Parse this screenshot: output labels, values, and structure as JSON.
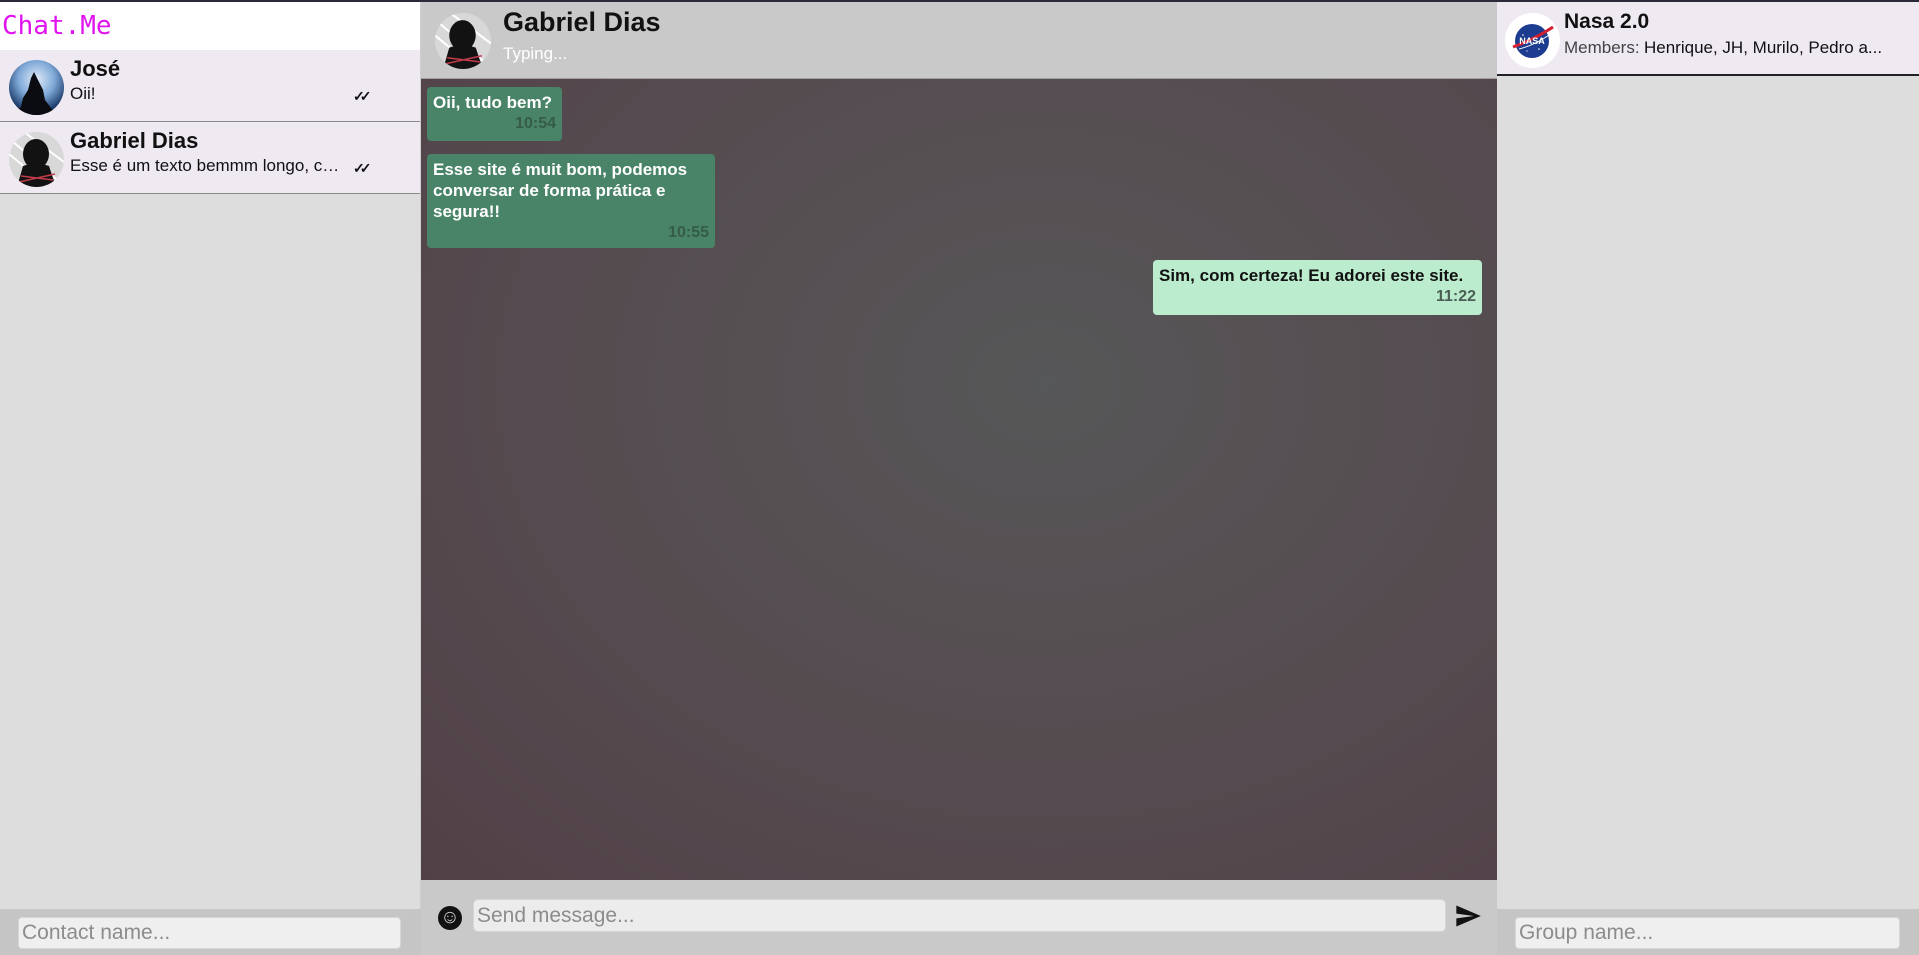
{
  "app": {
    "brand": "Chat.Me",
    "brand_color": "#e014ee"
  },
  "contacts": [
    {
      "name": "José",
      "last_message": "Oii!",
      "status": "✓✓",
      "avatar": "wolf-avatar"
    },
    {
      "name": "Gabriel Dias",
      "last_message": "Esse é um texto bemmm longo, certo?",
      "status": "✓✓",
      "avatar": "hooded-figure-avatar"
    }
  ],
  "contact_search": {
    "placeholder": "Contact name..."
  },
  "chat": {
    "name": "Gabriel Dias",
    "status": "Typing...",
    "messages": [
      {
        "direction": "in",
        "text": "Oii, tudo bem?",
        "time": "10:54"
      },
      {
        "direction": "in",
        "text": "Esse site é muit bom, podemos conversar de forma prática e segura!!",
        "time": "10:55"
      },
      {
        "direction": "out",
        "text": "Sim, com certeza! Eu adorei este site.",
        "time": "11:22"
      }
    ],
    "input": {
      "placeholder": "Send message...",
      "value": ""
    },
    "emoji_icon": "smiley-icon",
    "send_icon": "paper-plane-icon"
  },
  "group": {
    "name": "Nasa 2.0",
    "members_label": "Members:",
    "members": "Henrique, JH, Murilo, Pedro a...",
    "avatar": "nasa-logo"
  },
  "group_search": {
    "placeholder": "Group name..."
  },
  "colors": {
    "incoming_bubble": "#4a8468",
    "outgoing_bubble": "#bcecce",
    "header_bg": "#c9c9c9",
    "contact_bg": "#efe9f1"
  }
}
